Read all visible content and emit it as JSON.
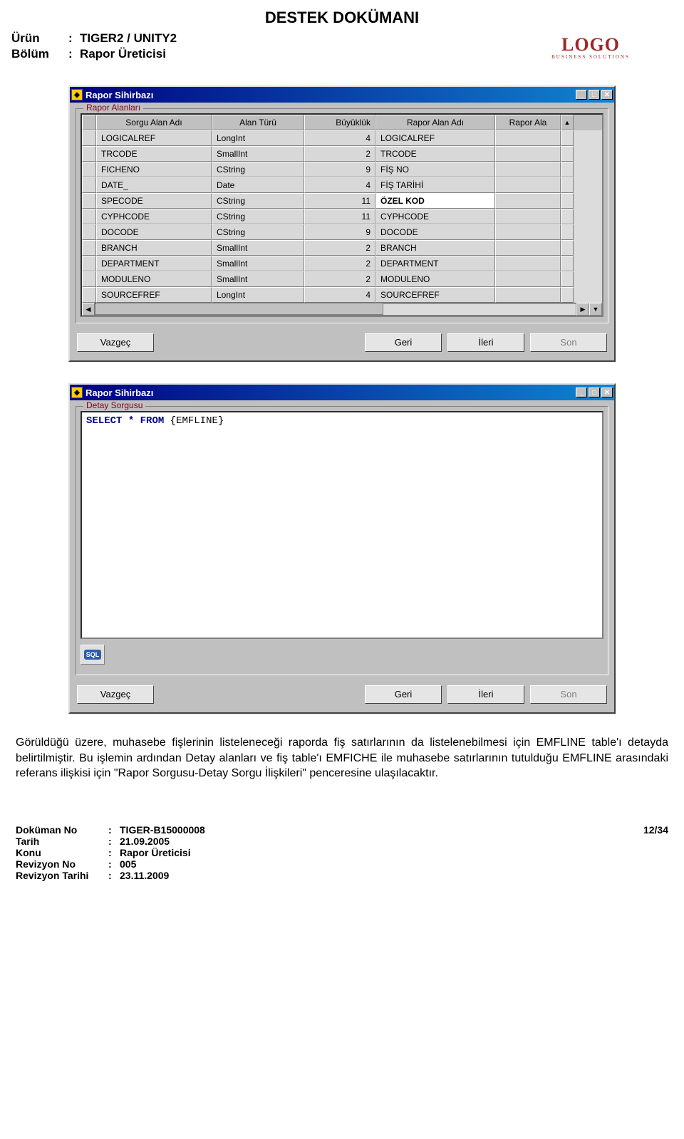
{
  "doc_title": "DESTEK DOKÜMANI",
  "header": {
    "product_label": "Ürün",
    "product_value": "TIGER2 / UNITY2",
    "section_label": "Bölüm",
    "section_value": "Rapor Üreticisi"
  },
  "logo": {
    "text": "LOGO",
    "subtitle": "BUSINESS SOLUTIONS"
  },
  "window1": {
    "title": "Rapor Sihirbazı",
    "fieldset": "Rapor Alanları",
    "columns": [
      "",
      "Sorgu Alan Adı",
      "Alan Türü",
      "Büyüklük",
      "Rapor Alan Adı",
      "Rapor Ala"
    ],
    "rows": [
      {
        "sorgu": "LOGICALREF",
        "tur": "LongInt",
        "boy": "4",
        "rapor": "LOGICALREF"
      },
      {
        "sorgu": "TRCODE",
        "tur": "SmallInt",
        "boy": "2",
        "rapor": "TRCODE"
      },
      {
        "sorgu": "FICHENO",
        "tur": "CString",
        "boy": "9",
        "rapor": "FİŞ NO"
      },
      {
        "sorgu": "DATE_",
        "tur": "Date",
        "boy": "4",
        "rapor": "FİŞ TARİHİ"
      },
      {
        "sorgu": "SPECODE",
        "tur": "CString",
        "boy": "11",
        "rapor": "ÖZEL KOD",
        "selected": true
      },
      {
        "sorgu": "CYPHCODE",
        "tur": "CString",
        "boy": "11",
        "rapor": "CYPHCODE"
      },
      {
        "sorgu": "DOCODE",
        "tur": "CString",
        "boy": "9",
        "rapor": "DOCODE"
      },
      {
        "sorgu": "BRANCH",
        "tur": "SmallInt",
        "boy": "2",
        "rapor": "BRANCH"
      },
      {
        "sorgu": "DEPARTMENT",
        "tur": "SmallInt",
        "boy": "2",
        "rapor": "DEPARTMENT"
      },
      {
        "sorgu": "MODULENO",
        "tur": "SmallInt",
        "boy": "2",
        "rapor": "MODULENO"
      },
      {
        "sorgu": "SOURCEFREF",
        "tur": "LongInt",
        "boy": "4",
        "rapor": "SOURCEFREF"
      }
    ],
    "ellipsis": "...",
    "buttons": {
      "cancel": "Vazgeç",
      "back": "Geri",
      "next": "İleri",
      "finish": "Son"
    }
  },
  "window2": {
    "title": "Rapor Sihirbazı",
    "fieldset": "Detay Sorgusu",
    "sql_select": "SELECT",
    "sql_star": "*",
    "sql_from": "FROM",
    "sql_rest": "{EMFLINE}",
    "sql_btn_label": "SQL",
    "buttons": {
      "cancel": "Vazgeç",
      "back": "Geri",
      "next": "İleri",
      "finish": "Son"
    }
  },
  "paragraph": "Görüldüğü üzere, muhasebe fişlerinin listeleneceği raporda fiş satırlarının da listelenebilmesi için EMFLINE table'ı detayda belirtilmiştir. Bu işlemin ardından Detay alanları ve fiş table'ı EMFICHE ile muhasebe satırlarının tutulduğu EMFLINE arasındaki referans ilişkisi için \"Rapor Sorgusu-Detay Sorgu İlişkileri\" penceresine ulaşılacaktır.",
  "footer": {
    "docno_label": "Doküman No",
    "docno_value": "TIGER-B15000008",
    "date_label": "Tarih",
    "date_value": "21.09.2005",
    "subject_label": "Konu",
    "subject_value": "Rapor Üreticisi",
    "revno_label": "Revizyon No",
    "revno_value": "005",
    "revdate_label": "Revizyon Tarihi",
    "revdate_value": "23.11.2009",
    "page": "12/34"
  }
}
